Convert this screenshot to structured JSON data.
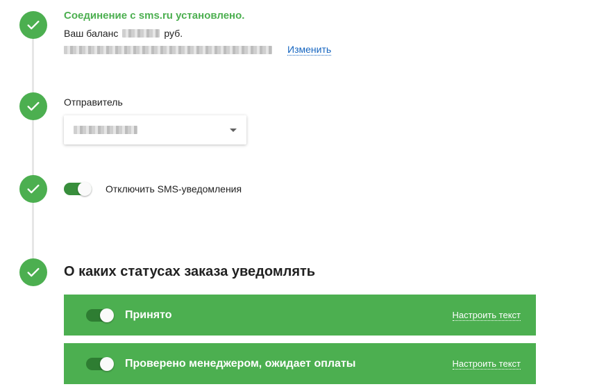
{
  "connection": {
    "title": "Соединение с sms.ru установлено.",
    "balance_prefix": "Ваш баланс",
    "balance_suffix": "руб.",
    "change_link": "Изменить"
  },
  "sender": {
    "label": "Отправитель"
  },
  "disable_sms": {
    "label": "Отключить SMS-уведомления",
    "enabled": true
  },
  "statuses": {
    "title": "О каких статусах заказа уведомлять",
    "items": [
      {
        "label": "Принято",
        "enabled": true,
        "configure_label": "Настроить текст"
      },
      {
        "label": "Проверено менеджером, ожидает оплаты",
        "enabled": true,
        "configure_label": "Настроить текст"
      }
    ]
  },
  "colors": {
    "accent_green": "#4caf50",
    "link_blue": "#1565c0"
  },
  "icons": {
    "step": "check-icon",
    "dropdown": "chevron-down-icon"
  }
}
